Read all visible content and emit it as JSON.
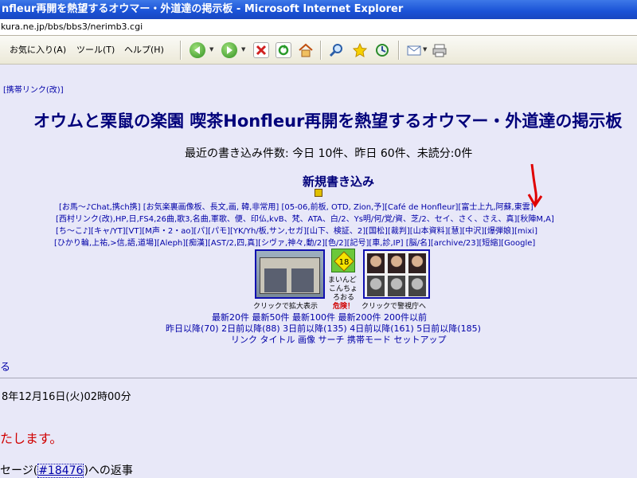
{
  "window": {
    "title": "nfleur再開を熱望するオウマー・外道達の掲示板 - Microsoft Internet Explorer"
  },
  "address": {
    "url": "kura.ne.jp/bbs/bbs3/nerimb3.cgi"
  },
  "toolbar": {
    "menus": [
      "お気に入り(A)",
      "ツール(T)",
      "ヘルプ(H)"
    ],
    "icons": [
      "back-icon",
      "forward-icon",
      "stop-icon",
      "refresh-icon",
      "home-icon",
      "search-icon",
      "favorites-icon",
      "history-icon",
      "mail-icon",
      "print-icon"
    ]
  },
  "page": {
    "mobile_link": "[携帯リンク(改)]",
    "title": "オウムと栗鼠の楽園 喫茶Honfleur再開を熱望するオウマー・外道達の掲示板",
    "post_counts": "最近の書き込み件数: 今日 10件、昨日 60件、未読分:0件",
    "new_post": "新規書き込み",
    "link_rows": [
      "[お馬～♪Chat,携ch携] [お気楽裏画像板、長文,画, 韓,非常用] [05-06,前板, OTD, Zion,予][Café de Honfleur][富士上九,阿蘇,東雲]",
      "[西村リンク(改),HP,日,FS4,26曲,歌3,名曲,軍歌、便、印仏,kvB、梵、ATA、白/2、Ys明/何/覚/資、芝/2、セイ、さく、さえ、真][秋陣M,A]",
      "[ち～こ♪][キャ/YT][VT][M声・2・ao][パ][パモ][YK/Yh/板,サン,セガ][山下、検証、2][国松][裁判][山本資料][慧][中沢][爆弾娘][mixi]",
      "[ひかり輪,上祐,>信,語,道場][Aleph][痴漢][AST/2,四,真][シヴァ,神々,動/2][色/2][記号][車,診,IP] [脳/名][archive/23][短縮][Google]"
    ],
    "images": {
      "left_caption": "クリックで拡大表示",
      "mid_badge": "18",
      "mid_caption1": "まいんど",
      "mid_caption2": "こんちょ",
      "mid_caption3": "ろおる",
      "mid_danger": "危険！",
      "right_caption": "クリックで警視庁へ"
    },
    "latest_links": "最新20件 最新50件 最新100件 最新200件 200件以前",
    "since_links": "昨日以降(70) 2日前以降(88) 3日前以降(135) 4日前以降(161) 5日前以降(185)",
    "bottom_links": "リンク タイトル 画像 サーチ 携帯モード セットアップ",
    "partial_ru": "る",
    "post_date": "8年12月16日(火)02時00分",
    "post_body": "たします。",
    "reply_prefix": "セージ(",
    "reply_link": "#18476",
    "reply_suffix": ")への返事"
  },
  "colors": {
    "titlebar": "#1a52d6",
    "page_bg": "#e8e8f8",
    "title_text": "#00007a",
    "link": "#0000a8",
    "red_text": "#d00000",
    "annotation_arrow": "#e00000"
  }
}
